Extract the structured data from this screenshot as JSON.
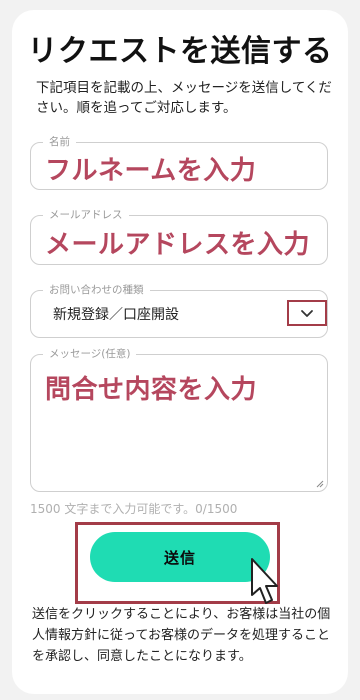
{
  "form": {
    "title": "リクエストを送信する",
    "description": "下記項目を記載の上、メッセージを送信してください。順を追ってご対応します。",
    "name_field": {
      "label": "名前",
      "annotation": "フルネームを入力"
    },
    "email_field": {
      "label": "メールアドレス",
      "annotation": "メールアドレスを入力"
    },
    "inquiry_type": {
      "label": "お問い合わせの種類",
      "selected": "新規登録／口座開設"
    },
    "message_field": {
      "label": "メッセージ(任意)",
      "annotation": "問合せ内容を入力"
    },
    "char_counter": "1500 文字まで入力可能です。0/1500",
    "submit_label": "送信",
    "consent_notice": "送信をクリックすることにより、お客様は当社の個人情報方針に従ってお客様のデータを処理することを承認し、同意したことになります。"
  },
  "colors": {
    "annotation_text": "#b5475e",
    "highlight_border": "#a33c48",
    "submit_button": "#1fdcb3",
    "field_border": "#cfcfcf",
    "label_gray": "#9a9a9a"
  },
  "icons": {
    "select_toggle": "chevron-down-icon",
    "cursor": "hand-pointer-icon"
  }
}
